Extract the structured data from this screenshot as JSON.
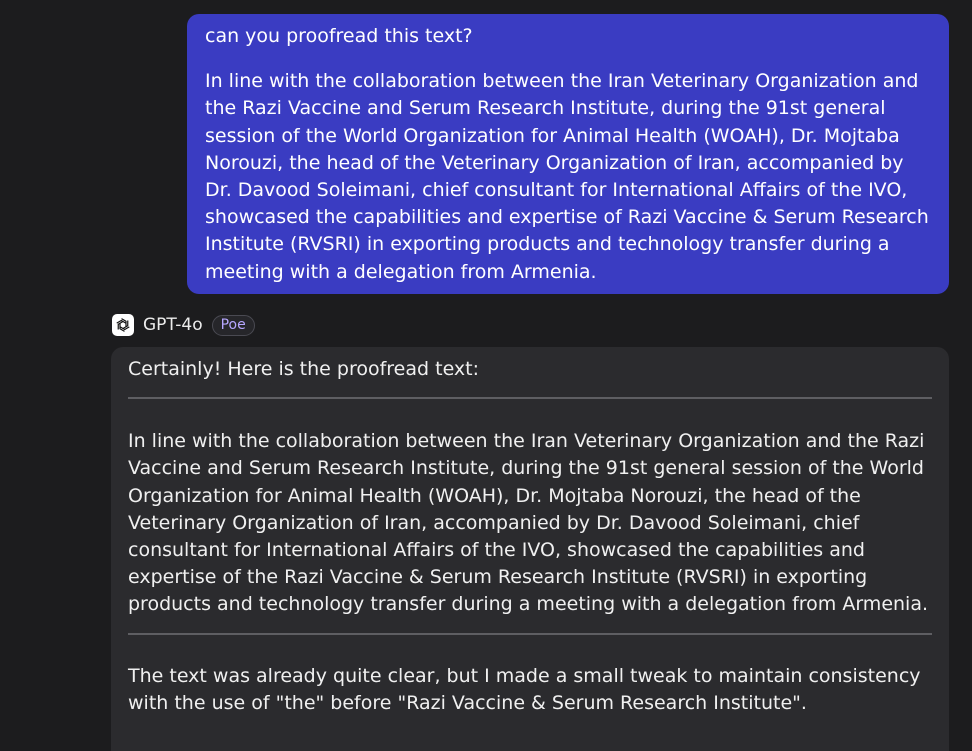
{
  "user_message": {
    "question": "can you proofread this text?",
    "text": "In line with the collaboration between the Iran Veterinary Organization and the Razi Vaccine and Serum Research Institute, during the 91st general session of the World Organization for Animal Health (WOAH), Dr. Mojtaba Norouzi, the head of the Veterinary Organization of Iran, accompanied by Dr. Davood Soleimani, chief consultant for International Affairs of the IVO, showcased the capabilities and expertise of Razi Vaccine & Serum Research Institute (RVSRI) in exporting products and technology transfer during a meeting with a delegation from Armenia."
  },
  "bot": {
    "name": "GPT-4o",
    "badge": "Poe",
    "icon": "openai-logo-icon",
    "intro": "Certainly! Here is the proofread text:",
    "proofread": "In line with the collaboration between the Iran Veterinary Organization and the Razi Vaccine and Serum Research Institute, during the 91st general session of the World Organization for Animal Health (WOAH), Dr. Mojtaba Norouzi, the head of the Veterinary Organization of Iran, accompanied by Dr. Davood Soleimani, chief consultant for International Affairs of the IVO, showcased the capabilities and expertise of the Razi Vaccine & Serum Research Institute (RVSRI) in exporting products and technology transfer during a meeting with a delegation from Armenia.",
    "note": "The text was already quite clear, but I made a small tweak to maintain consistency with the use of \"the\" before \"Razi Vaccine & Serum Research Institute\"."
  },
  "colors": {
    "background": "#1c1c1e",
    "user_bubble": "#3a3cc2",
    "bot_bubble": "#2b2b2e",
    "badge_text": "#b6a7ff"
  }
}
